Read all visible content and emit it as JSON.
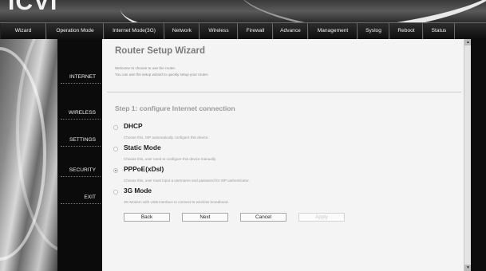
{
  "nav": [
    "Wizard",
    "Operation Mode",
    "Internet Mode(3G)",
    "Network",
    "Wireless",
    "Firewall",
    "Advance",
    "Management",
    "Syslog",
    "Reboot",
    "Status"
  ],
  "sidebar": [
    "INTERNET",
    "WIRELESS",
    "SETTINGS",
    "SECURITY",
    "EXIT"
  ],
  "page": {
    "title": "Router Setup Wizard",
    "welcome": "Welcome to choose to use the router.",
    "intro": "You can use the setup wizard to quickly setup your router.",
    "step_title": "Step 1: configure Internet connection"
  },
  "options": [
    {
      "label": "DHCP",
      "help": "Choose this, ISP automatically configure this device.",
      "selected": false
    },
    {
      "label": "Static Mode",
      "help": "Choose this, user need to configure this device manually.",
      "selected": false
    },
    {
      "label": "PPPoE(xDsl)",
      "help": "Choose this, user must input a username and password for ISP authenticator.",
      "selected": true
    },
    {
      "label": "3G Mode",
      "help": "3G Modem with USB interface to connect to wireless broadband.",
      "selected": false
    }
  ],
  "buttons": {
    "back": "Back",
    "next": "Next",
    "cancel": "Cancel",
    "apply": "Apply"
  },
  "icons": {
    "scroll_up": "triangle-up-icon",
    "scroll_down": "triangle-down-icon"
  }
}
